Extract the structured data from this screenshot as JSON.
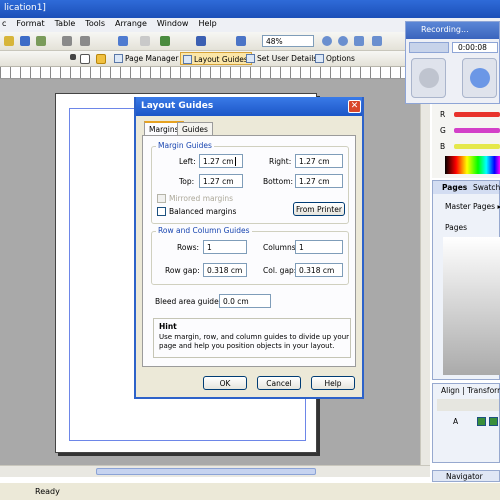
{
  "window": {
    "title": "lication1]"
  },
  "menu": [
    "c",
    "Format",
    "Table",
    "Tools",
    "Arrange",
    "Window",
    "Help"
  ],
  "toolbar": {
    "zoom": "48%"
  },
  "toolbar2": {
    "page_manager": "Page Manager",
    "layout_guides": "Layout Guides",
    "set_user_details": "Set User Details",
    "options": "Options"
  },
  "status": {
    "text": "Ready"
  },
  "dialog": {
    "title": "Layout Guides",
    "close": "✕",
    "tabs": [
      "Margins",
      "Guides"
    ],
    "margin_guides": {
      "group_label": "Margin Guides",
      "left_label": "Left:",
      "left_value": "1.27 cm",
      "right_label": "Right:",
      "right_value": "1.27 cm",
      "top_label": "Top:",
      "top_value": "1.27 cm",
      "bottom_label": "Bottom:",
      "bottom_value": "1.27 cm",
      "mirrored": "Mirrored margins",
      "balanced": "Balanced margins",
      "from_printer": "From Printer"
    },
    "row_column": {
      "group_label": "Row and Column Guides",
      "rows_label": "Rows:",
      "rows_value": "1",
      "columns_label": "Columns:",
      "columns_value": "1",
      "row_gap_label": "Row gap:",
      "row_gap_value": "0.318 cm",
      "col_gap_label": "Col. gap:",
      "col_gap_value": "0.318 cm"
    },
    "bleed": {
      "label": "Bleed area guides:",
      "value": "0.0 cm"
    },
    "hint": {
      "title": "Hint",
      "text": "Use margin, row, and column guides to divide up your page and help you position objects in your layout."
    },
    "buttons": {
      "ok": "OK",
      "cancel": "Cancel",
      "help": "Help"
    }
  },
  "recorder": {
    "title": "Recording...",
    "time": "0:00:08"
  },
  "color_panel": {
    "labels": [
      "R",
      "G",
      "B"
    ],
    "bar_colors": [
      "#e8332c",
      "#d340c8",
      "#e5e84a"
    ]
  },
  "pages_panel": {
    "tabs": [
      "Pages",
      "Swatche"
    ],
    "master_pages": "Master Pages ▸",
    "pages_label": "Pages"
  },
  "align_panel": {
    "title": "Align | Transform | ...",
    "row_label": "A"
  },
  "navigator": {
    "label": "Navigator"
  }
}
